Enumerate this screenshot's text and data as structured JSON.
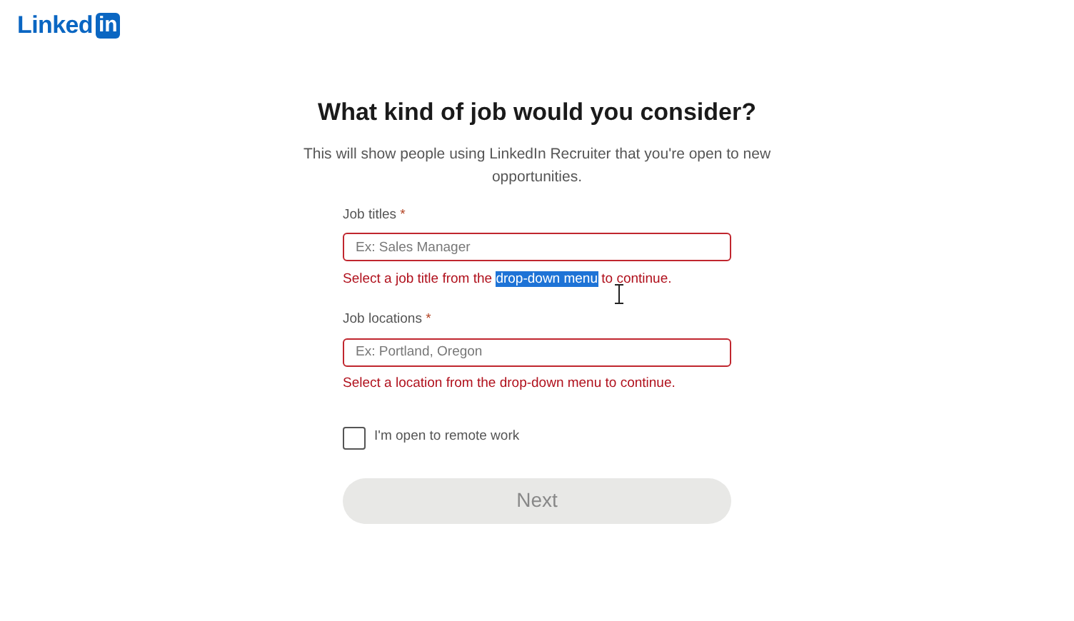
{
  "logo": {
    "word": "Linked",
    "badge": "in"
  },
  "heading": "What kind of job would you consider?",
  "subtitle": "This will show people using LinkedIn Recruiter that you're open to new opportunities.",
  "fields": [
    {
      "label": "Job titles",
      "required_mark": "*",
      "placeholder": "Ex: Sales Manager",
      "invalid": true,
      "error": [
        {
          "text": "Select a job title from the ",
          "selected": false
        },
        {
          "text": "drop-down menu",
          "selected": true
        },
        {
          "text": " to continue.",
          "selected": false
        }
      ]
    },
    {
      "label": "Job locations",
      "required_mark": "*",
      "placeholder": "Ex: Portland, Oregon",
      "invalid": true,
      "error": [
        {
          "text": "Select a location from the drop-down menu to continue.",
          "selected": false
        }
      ]
    }
  ],
  "remote": {
    "label": "I'm open to remote work",
    "checked": false
  },
  "next_button": {
    "label": "Next",
    "disabled": true
  }
}
